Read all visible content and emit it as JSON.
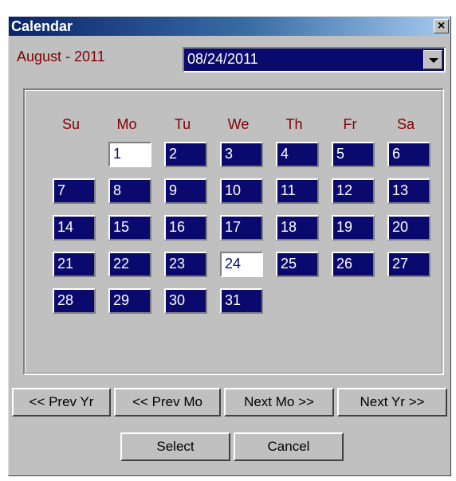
{
  "window": {
    "title": "Calendar",
    "close_label": "×"
  },
  "header": {
    "month_label": "August - 2011",
    "date_value": "08/24/2011"
  },
  "days_of_week": [
    "Su",
    "Mo",
    "Tu",
    "We",
    "Th",
    "Fr",
    "Sa"
  ],
  "days": [
    "1",
    "2",
    "3",
    "4",
    "5",
    "6",
    "7",
    "8",
    "9",
    "10",
    "11",
    "12",
    "13",
    "14",
    "15",
    "16",
    "17",
    "18",
    "19",
    "20",
    "21",
    "22",
    "23",
    "24",
    "25",
    "26",
    "27",
    "28",
    "29",
    "30",
    "31"
  ],
  "highlighted_days": [
    "1",
    "24"
  ],
  "nav": {
    "prev_year": "<< Prev Yr",
    "prev_month": "<< Prev Mo",
    "next_month": "Next Mo >>",
    "next_year": "Next Yr >>"
  },
  "actions": {
    "select": "Select",
    "cancel": "Cancel"
  },
  "colors": {
    "accent_navy": "#0a0a6e",
    "label_maroon": "#800000",
    "face": "#c0c0c0"
  }
}
